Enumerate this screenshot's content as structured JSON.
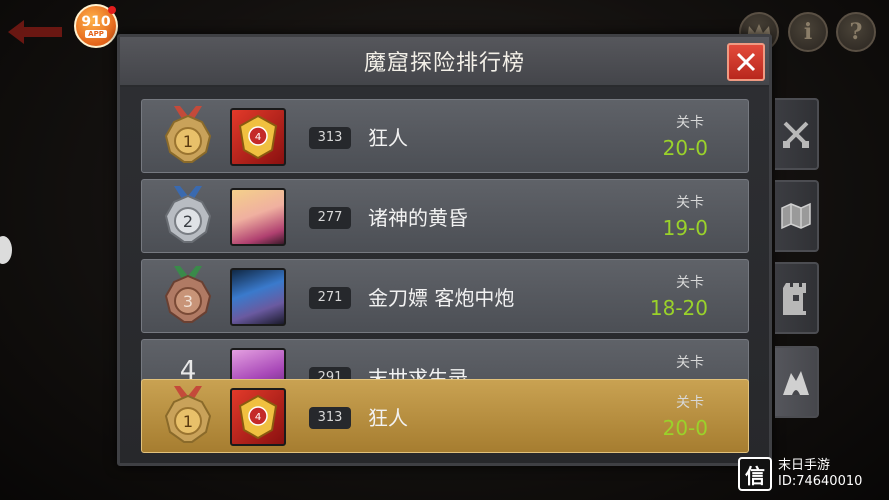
{
  "app": {
    "logo_number": "910",
    "logo_sub": "APP"
  },
  "top_icons": [
    {
      "name": "crown-icon",
      "glyph": "♛"
    },
    {
      "name": "info-icon",
      "glyph": "i"
    },
    {
      "name": "help-icon",
      "glyph": "?"
    }
  ],
  "panel": {
    "title": "魔窟探险排行榜",
    "stage_label": "关卡"
  },
  "rows": [
    {
      "rank": 1,
      "medal": "gold",
      "level": "313",
      "name": "狂人",
      "stage": "20-0"
    },
    {
      "rank": 2,
      "medal": "silver",
      "level": "277",
      "name": "诸神的黄昏",
      "stage": "19-0"
    },
    {
      "rank": 3,
      "medal": "bronze",
      "level": "271",
      "name": "金刀嫖 客炮中炮",
      "stage": "18-20"
    },
    {
      "rank": 4,
      "medal": "",
      "level": "291",
      "name": "末世求生录",
      "stage": ""
    }
  ],
  "my_rank": {
    "rank": 1,
    "medal": "gold",
    "level": "313",
    "name": "狂人",
    "stage": "20-0"
  },
  "side_tabs": [
    {
      "name": "crossed-swords-icon",
      "active": false
    },
    {
      "name": "map-icon",
      "active": false
    },
    {
      "name": "tower-icon",
      "active": false
    },
    {
      "name": "cave-icon",
      "active": true
    }
  ],
  "watermark": {
    "icon_text": "信",
    "line1": "末日手游",
    "line2": "ID:74640010"
  },
  "colors": {
    "stage_value": "#9ad22a",
    "close_button": "#d13b2c",
    "highlight_row": "#b88e3c"
  }
}
